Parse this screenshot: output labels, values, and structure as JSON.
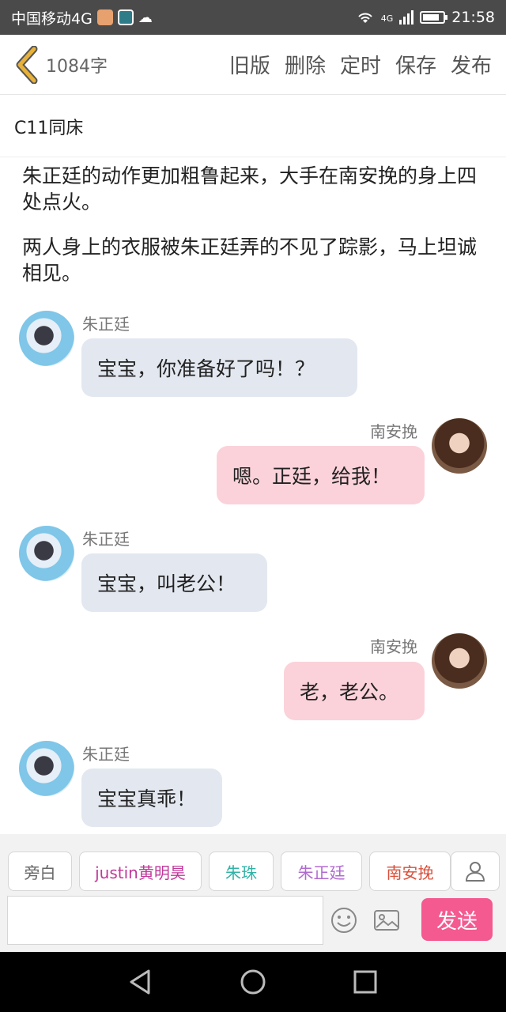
{
  "status_bar": {
    "carrier": "中国移动4G",
    "network": "4G",
    "time": "21:58"
  },
  "toolbar": {
    "word_count": "1084字",
    "actions": [
      "旧版",
      "删除",
      "定时",
      "保存",
      "发布"
    ]
  },
  "chapter": {
    "title": "C11同床"
  },
  "narrative": [
    "朱正廷的动作更加粗鲁起来，大手在南安挽的身上四处点火。",
    "两人身上的衣服被朱正廷弄的不见了踪影，马上坦诚相见。"
  ],
  "messages": [
    {
      "speaker": "朱正廷",
      "side": "left",
      "text": "宝宝，你准备好了吗！？"
    },
    {
      "speaker": "南安挽",
      "side": "right",
      "text": "嗯。正廷，给我！"
    },
    {
      "speaker": "朱正廷",
      "side": "left",
      "text": "宝宝，叫老公！"
    },
    {
      "speaker": "南安挽",
      "side": "right",
      "text": "老，老公。"
    },
    {
      "speaker": "朱正廷",
      "side": "left",
      "text": "宝宝真乖！"
    }
  ],
  "characters": [
    {
      "label": "旁白",
      "color": "#666666"
    },
    {
      "label": "justin黄明昊",
      "color": "#c0389a"
    },
    {
      "label": "朱珠",
      "color": "#2fb3a6"
    },
    {
      "label": "朱正廷",
      "color": "#b06ad0"
    },
    {
      "label": "南安挽",
      "color": "#d9503a"
    }
  ],
  "composer": {
    "input_value": "",
    "send_label": "发送"
  },
  "colors": {
    "accent": "#f4598f",
    "back_arrow": "#e7b13a",
    "bubble_left": "#e3e8f0",
    "bubble_right": "#fbd2da"
  }
}
